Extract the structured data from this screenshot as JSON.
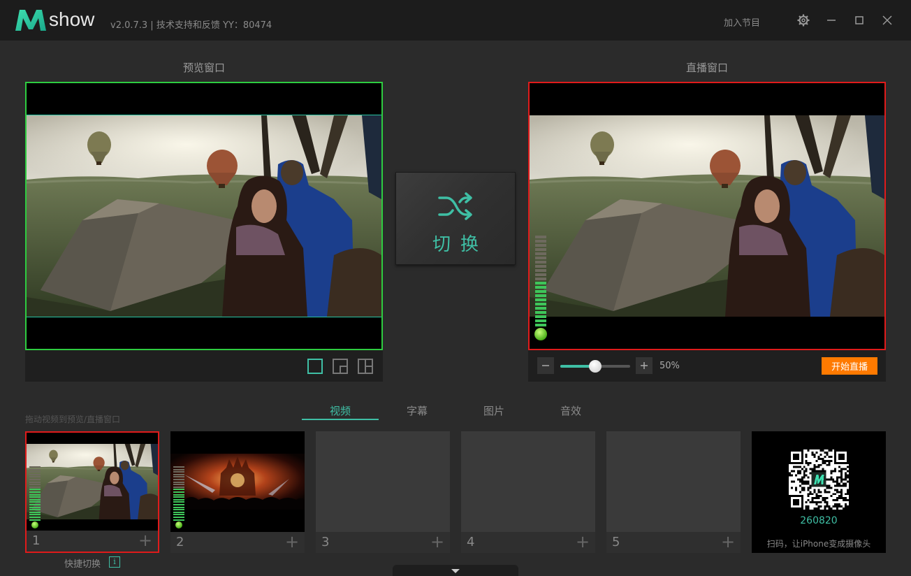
{
  "app": {
    "logo_text": "show",
    "version": "v2.0.7.3  |  技术支持和反馈 YY：80474",
    "add_program": "加入节目"
  },
  "preview": {
    "title": "预览窗口"
  },
  "live": {
    "title": "直播窗口",
    "volume_percent": 50,
    "volume_label": "50%",
    "go_live_label": "开始直播"
  },
  "switch": {
    "label": "切换"
  },
  "tabs": [
    {
      "label": "视频",
      "active": true
    },
    {
      "label": "字幕",
      "active": false
    },
    {
      "label": "图片",
      "active": false
    },
    {
      "label": "音效",
      "active": false
    }
  ],
  "drag_hint": "拖动视频到预览/直播窗口",
  "thumbnails": [
    {
      "number": "1",
      "has_video": true,
      "scene": "balloon",
      "selected_live": true
    },
    {
      "number": "2",
      "has_video": true,
      "scene": "concert",
      "selected_live": false
    },
    {
      "number": "3",
      "has_video": false
    },
    {
      "number": "4",
      "has_video": false
    },
    {
      "number": "5",
      "has_video": false
    }
  ],
  "qr": {
    "code": "260820",
    "hint": "扫码，让iPhone变成摄像头"
  },
  "quick_switch": {
    "label": "快捷切换",
    "info_icon": "i"
  },
  "colors": {
    "accent": "#3fbfa5",
    "preview_border": "#2ecc40",
    "live_border": "#e01b1b",
    "go_live": "#ff7a00"
  }
}
